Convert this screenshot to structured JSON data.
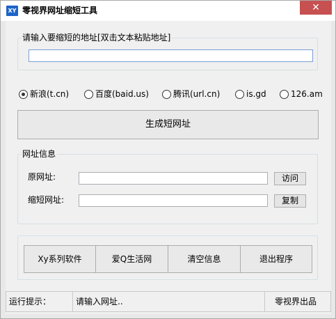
{
  "window": {
    "icon_text": "XY",
    "title": "零视界网址缩短工具",
    "close_symbol": "✕"
  },
  "input_group": {
    "legend": "请输入要缩短的地址[双击文本粘贴地址]",
    "value": ""
  },
  "services": [
    {
      "label": "新浪(t.cn)",
      "checked": true
    },
    {
      "label": "百度(baid.us)",
      "checked": false
    },
    {
      "label": "腾讯(url.cn)",
      "checked": false
    },
    {
      "label": "is.gd",
      "checked": false
    },
    {
      "label": "126.am",
      "checked": false
    }
  ],
  "generate_button": "生成短网址",
  "info_group": {
    "legend": "网址信息",
    "original_label": "原网址:",
    "original_value": "",
    "visit_button": "访问",
    "short_label": "缩短网址:",
    "short_value": "",
    "copy_button": "复制"
  },
  "bottom_buttons": {
    "xy_software": "Xy系列软件",
    "aiq_life": "爱Q生活网",
    "clear_info": "清空信息",
    "exit": "退出程序"
  },
  "status": {
    "label": "运行提示：",
    "message": "请输入网址..",
    "credit": "零视界出品"
  }
}
